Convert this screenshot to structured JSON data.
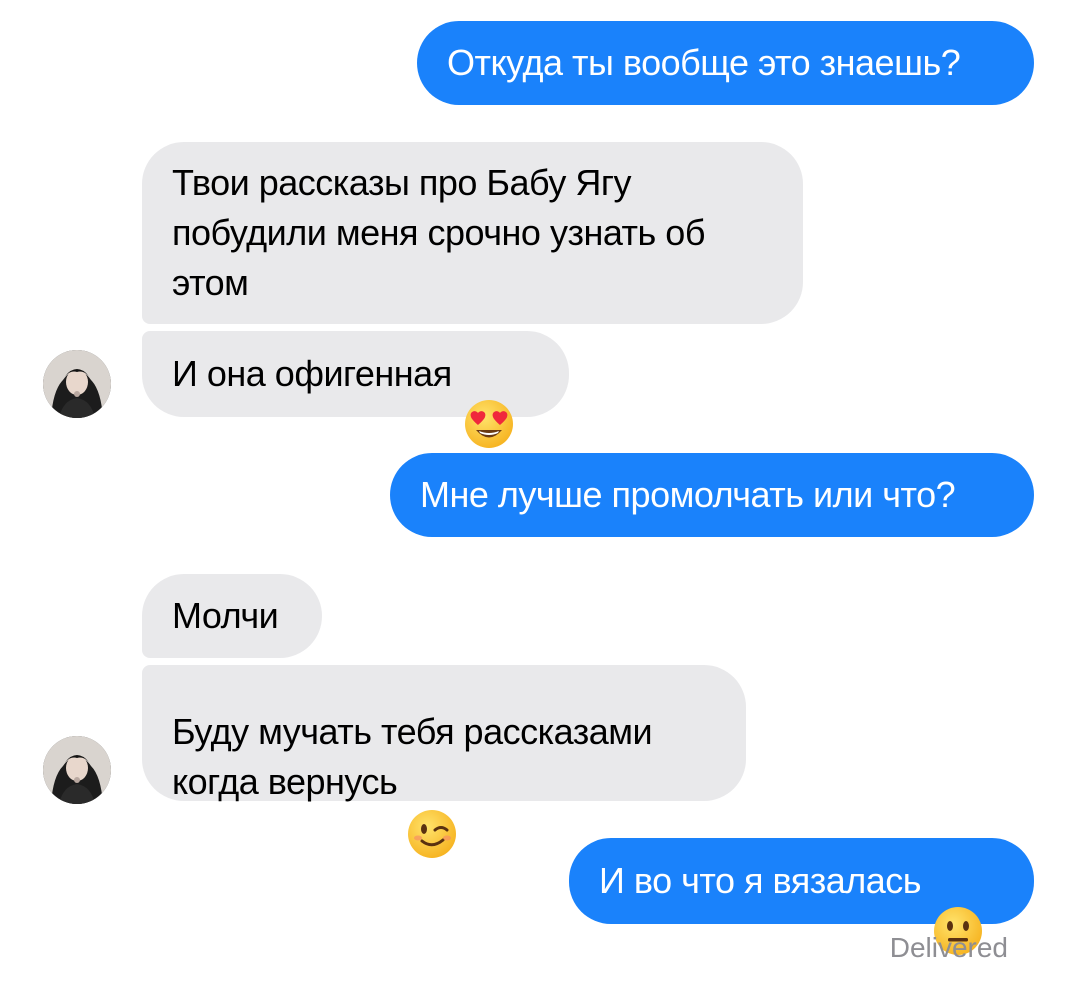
{
  "messages": [
    {
      "direction": "outgoing",
      "text": "Откуда ты вообще это знаешь?"
    },
    {
      "direction": "incoming",
      "text": "Твои рассказы про Бабу Ягу\nпобудили меня срочно узнать об\nэтом"
    },
    {
      "direction": "incoming",
      "text": "И она офигенная",
      "emoji": "heart-eyes-emoji"
    },
    {
      "direction": "outgoing",
      "text": "Мне лучше промолчать или что?"
    },
    {
      "direction": "incoming",
      "text": "Молчи"
    },
    {
      "direction": "incoming",
      "text": "Буду мучать тебя рассказами\nкогда вернусь",
      "emoji": "winking-face-emoji"
    },
    {
      "direction": "outgoing",
      "text": "И во что я вязалась",
      "emoji": "neutral-face-emoji"
    }
  ],
  "status": "Delivered",
  "colors": {
    "outgoing_bubble": "#1a82fb",
    "incoming_bubble": "#e9e9eb",
    "status_text": "#8e8e93"
  }
}
